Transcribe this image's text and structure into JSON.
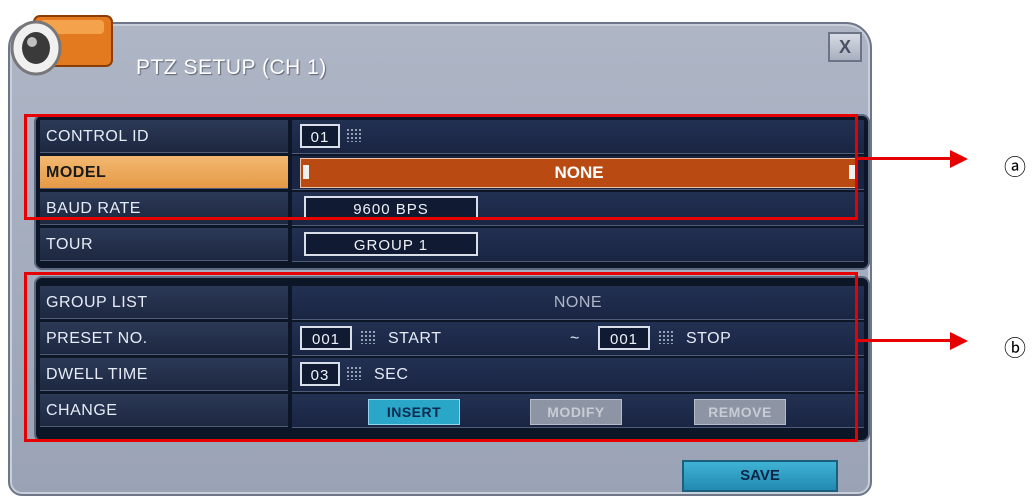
{
  "dialog": {
    "title": "PTZ SETUP (CH 1)",
    "close_label": "X",
    "save_label": "SAVE"
  },
  "settings": {
    "control_id": {
      "label": "CONTROL ID",
      "value": "01"
    },
    "model": {
      "label": "MODEL",
      "value": "NONE"
    },
    "baud_rate": {
      "label": "BAUD RATE",
      "value": "9600 BPS"
    },
    "tour": {
      "label": "TOUR",
      "value": "GROUP 1"
    }
  },
  "tour_config": {
    "group_list": {
      "label": "GROUP LIST",
      "value": "NONE"
    },
    "preset": {
      "label": "PRESET NO.",
      "start_value": "001",
      "start_label": "START",
      "separator": "~",
      "stop_value": "001",
      "stop_label": "STOP"
    },
    "dwell": {
      "label": "DWELL TIME",
      "value": "03",
      "unit": "SEC"
    },
    "change": {
      "label": "CHANGE",
      "insert": "INSERT",
      "modify": "MODIFY",
      "remove": "REMOVE"
    }
  },
  "annotations": {
    "a": "ⓐ",
    "b": "ⓑ"
  },
  "colors": {
    "highlight": "#e59a47",
    "model_bar": "#b84a12",
    "callout": "#e60000",
    "button_active": "#2aa6c9"
  }
}
